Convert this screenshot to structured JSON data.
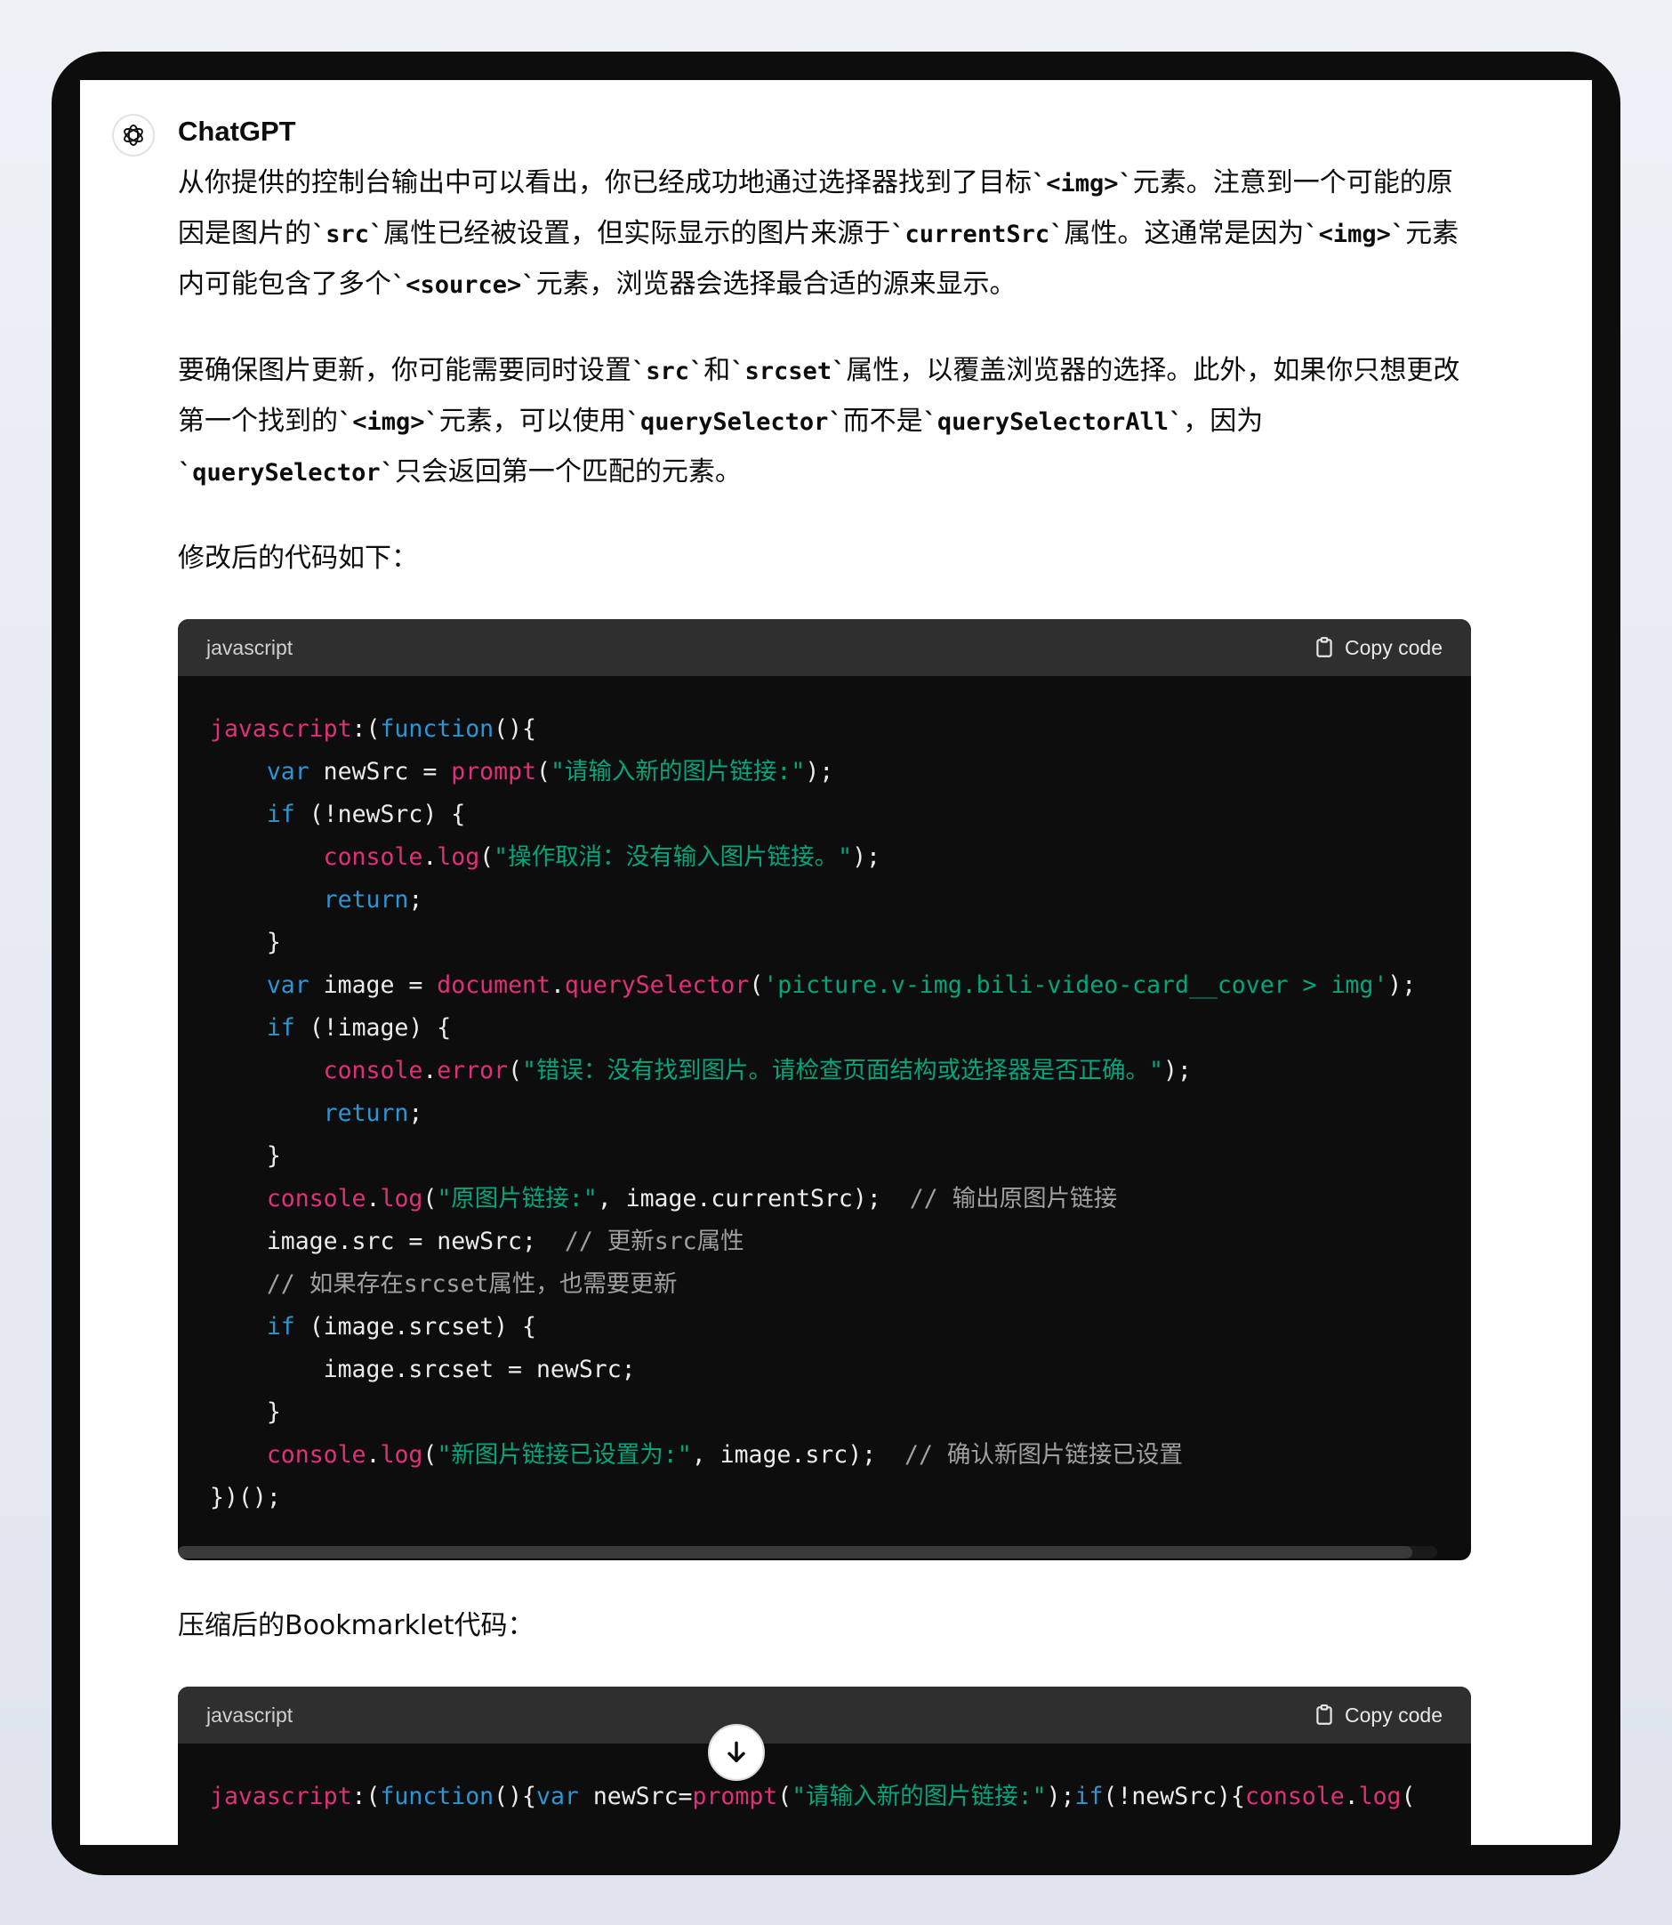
{
  "author": "ChatGPT",
  "paragraphs": [
    [
      {
        "t": "text",
        "v": "从你提供的控制台输出中可以看出，你已经成功地通过选择器找到了目标"
      },
      {
        "t": "code",
        "v": "`<img>`"
      },
      {
        "t": "text",
        "v": "元素。注意到一个可能的原因是图片的"
      },
      {
        "t": "code",
        "v": "`src`"
      },
      {
        "t": "text",
        "v": "属性已经被设置，但实际显示的图片来源于"
      },
      {
        "t": "code",
        "v": "`currentSrc`"
      },
      {
        "t": "text",
        "v": "属性。这通常是因为"
      },
      {
        "t": "code",
        "v": "`<img>`"
      },
      {
        "t": "text",
        "v": "元素内可能包含了多个"
      },
      {
        "t": "code",
        "v": "`<source>`"
      },
      {
        "t": "text",
        "v": "元素，浏览器会选择最合适的源来显示。"
      }
    ],
    [
      {
        "t": "text",
        "v": "要确保图片更新，你可能需要同时设置"
      },
      {
        "t": "code",
        "v": "`src`"
      },
      {
        "t": "text",
        "v": "和"
      },
      {
        "t": "code",
        "v": "`srcset`"
      },
      {
        "t": "text",
        "v": "属性，以覆盖浏览器的选择。此外，如果你只想更改第一个找到的"
      },
      {
        "t": "code",
        "v": "`<img>`"
      },
      {
        "t": "text",
        "v": "元素，可以使用"
      },
      {
        "t": "code",
        "v": "`querySelector`"
      },
      {
        "t": "text",
        "v": "而不是"
      },
      {
        "t": "code",
        "v": "`querySelectorAll`"
      },
      {
        "t": "text",
        "v": "，因为"
      },
      {
        "t": "code",
        "v": "`querySelector`"
      },
      {
        "t": "text",
        "v": "只会返回第一个匹配的元素。"
      }
    ]
  ],
  "intro_modified": "修改后的代码如下：",
  "intro_bookmarklet": "压缩后的Bookmarklet代码：",
  "code_blocks": [
    {
      "language": "javascript",
      "copy_label": "Copy code",
      "scroll_fraction": 0.98,
      "lines": [
        [
          [
            "fn",
            "javascript"
          ],
          [
            "p",
            ":("
          ],
          [
            "kw",
            "function"
          ],
          [
            "p",
            "(){"
          ]
        ],
        [
          [
            "p",
            "    "
          ],
          [
            "kw",
            "var"
          ],
          [
            "p",
            " newSrc = "
          ],
          [
            "fn",
            "prompt"
          ],
          [
            "p",
            "("
          ],
          [
            "str",
            "\"请输入新的图片链接:\""
          ],
          [
            "p",
            ");"
          ]
        ],
        [
          [
            "p",
            "    "
          ],
          [
            "kw",
            "if"
          ],
          [
            "p",
            " (!newSrc) {"
          ]
        ],
        [
          [
            "p",
            "        "
          ],
          [
            "fn",
            "console"
          ],
          [
            "p",
            "."
          ],
          [
            "fn",
            "log"
          ],
          [
            "p",
            "("
          ],
          [
            "str",
            "\"操作取消：没有输入图片链接。\""
          ],
          [
            "p",
            ");"
          ]
        ],
        [
          [
            "p",
            "        "
          ],
          [
            "kw",
            "return"
          ],
          [
            "p",
            ";"
          ]
        ],
        [
          [
            "p",
            "    }"
          ]
        ],
        [
          [
            "p",
            "    "
          ],
          [
            "kw",
            "var"
          ],
          [
            "p",
            " image = "
          ],
          [
            "fn",
            "document"
          ],
          [
            "p",
            "."
          ],
          [
            "fn",
            "querySelector"
          ],
          [
            "p",
            "("
          ],
          [
            "str",
            "'picture.v-img.bili-video-card__cover > img'"
          ],
          [
            "p",
            ");"
          ]
        ],
        [
          [
            "p",
            "    "
          ],
          [
            "kw",
            "if"
          ],
          [
            "p",
            " (!image) {"
          ]
        ],
        [
          [
            "p",
            "        "
          ],
          [
            "fn",
            "console"
          ],
          [
            "p",
            "."
          ],
          [
            "fn",
            "error"
          ],
          [
            "p",
            "("
          ],
          [
            "str",
            "\"错误：没有找到图片。请检查页面结构或选择器是否正确。\""
          ],
          [
            "p",
            ");"
          ]
        ],
        [
          [
            "p",
            "        "
          ],
          [
            "kw",
            "return"
          ],
          [
            "p",
            ";"
          ]
        ],
        [
          [
            "p",
            "    }"
          ]
        ],
        [
          [
            "p",
            "    "
          ],
          [
            "fn",
            "console"
          ],
          [
            "p",
            "."
          ],
          [
            "fn",
            "log"
          ],
          [
            "p",
            "("
          ],
          [
            "str",
            "\"原图片链接:\""
          ],
          [
            "p",
            ", image.currentSrc);  "
          ],
          [
            "cm",
            "// 输出原图片链接"
          ]
        ],
        [
          [
            "p",
            "    image.src = newSrc;  "
          ],
          [
            "cm",
            "// 更新src属性"
          ]
        ],
        [
          [
            "p",
            "    "
          ],
          [
            "cm",
            "// 如果存在srcset属性，也需要更新"
          ]
        ],
        [
          [
            "p",
            "    "
          ],
          [
            "kw",
            "if"
          ],
          [
            "p",
            " (image.srcset) {"
          ]
        ],
        [
          [
            "p",
            "        image.srcset = newSrc;"
          ]
        ],
        [
          [
            "p",
            "    }"
          ]
        ],
        [
          [
            "p",
            "    "
          ],
          [
            "fn",
            "console"
          ],
          [
            "p",
            "."
          ],
          [
            "fn",
            "log"
          ],
          [
            "p",
            "("
          ],
          [
            "str",
            "\"新图片链接已设置为:\""
          ],
          [
            "p",
            ", image.src);  "
          ],
          [
            "cm",
            "// 确认新图片链接已设置"
          ]
        ],
        [
          [
            "p",
            "})();"
          ]
        ]
      ]
    },
    {
      "language": "javascript",
      "copy_label": "Copy code",
      "scroll_fraction": 0.2,
      "lines": [
        [
          [
            "fn",
            "javascript"
          ],
          [
            "p",
            ":("
          ],
          [
            "kw",
            "function"
          ],
          [
            "p",
            "(){"
          ],
          [
            "kw",
            "var"
          ],
          [
            "p",
            " newSrc="
          ],
          [
            "fn",
            "prompt"
          ],
          [
            "p",
            "("
          ],
          [
            "str",
            "\"请输入新的图片链接:\""
          ],
          [
            "p",
            ");"
          ],
          [
            "kw",
            "if"
          ],
          [
            "p",
            "(!newSrc){"
          ],
          [
            "fn",
            "console"
          ],
          [
            "p",
            "."
          ],
          [
            "fn",
            "log"
          ],
          [
            "p",
            "("
          ]
        ]
      ]
    }
  ]
}
